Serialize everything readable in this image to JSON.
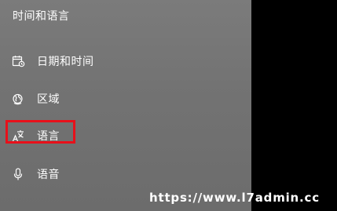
{
  "sidebar": {
    "title": "时间和语言",
    "items": [
      {
        "id": "datetime",
        "label": "日期和时间",
        "icon": "calendar-clock-icon"
      },
      {
        "id": "region",
        "label": "区域",
        "icon": "globe-icon"
      },
      {
        "id": "language",
        "label": "语言",
        "icon": "language-icon",
        "highlighted": true
      },
      {
        "id": "speech",
        "label": "语音",
        "icon": "microphone-icon"
      }
    ]
  },
  "highlight_color": "#e8101a",
  "watermark": "https://www.l7admin.cc"
}
